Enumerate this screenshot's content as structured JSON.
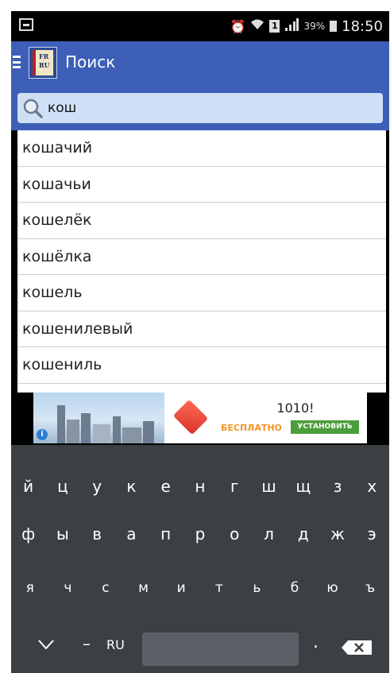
{
  "status_bar": {
    "battery": "39%",
    "time": "18:50",
    "sim": "1"
  },
  "app_bar": {
    "title": "Поиск",
    "logo_top": "FR",
    "logo_bottom": "RU"
  },
  "search": {
    "value": "кош"
  },
  "results": [
    "кошачий",
    "кошачьи",
    "кошелёк",
    "кошёлка",
    "кошель",
    "кошенилевый",
    "кошениль"
  ],
  "ad": {
    "title": "1010!",
    "free": "БЕСПЛАТНО",
    "install": "УСТАНОВИТЬ",
    "info": "i"
  },
  "keyboard": {
    "row1": [
      "й",
      "ц",
      "у",
      "к",
      "е",
      "н",
      "г",
      "ш",
      "щ",
      "з",
      "х"
    ],
    "row2": [
      "ф",
      "ы",
      "в",
      "а",
      "п",
      "р",
      "о",
      "л",
      "д",
      "ж",
      "э"
    ],
    "row3": [
      "я",
      "ч",
      "с",
      "м",
      "и",
      "т",
      "ь",
      "б",
      "ю",
      "ъ"
    ],
    "dash": "–",
    "lang": "RU",
    "dot": "."
  }
}
